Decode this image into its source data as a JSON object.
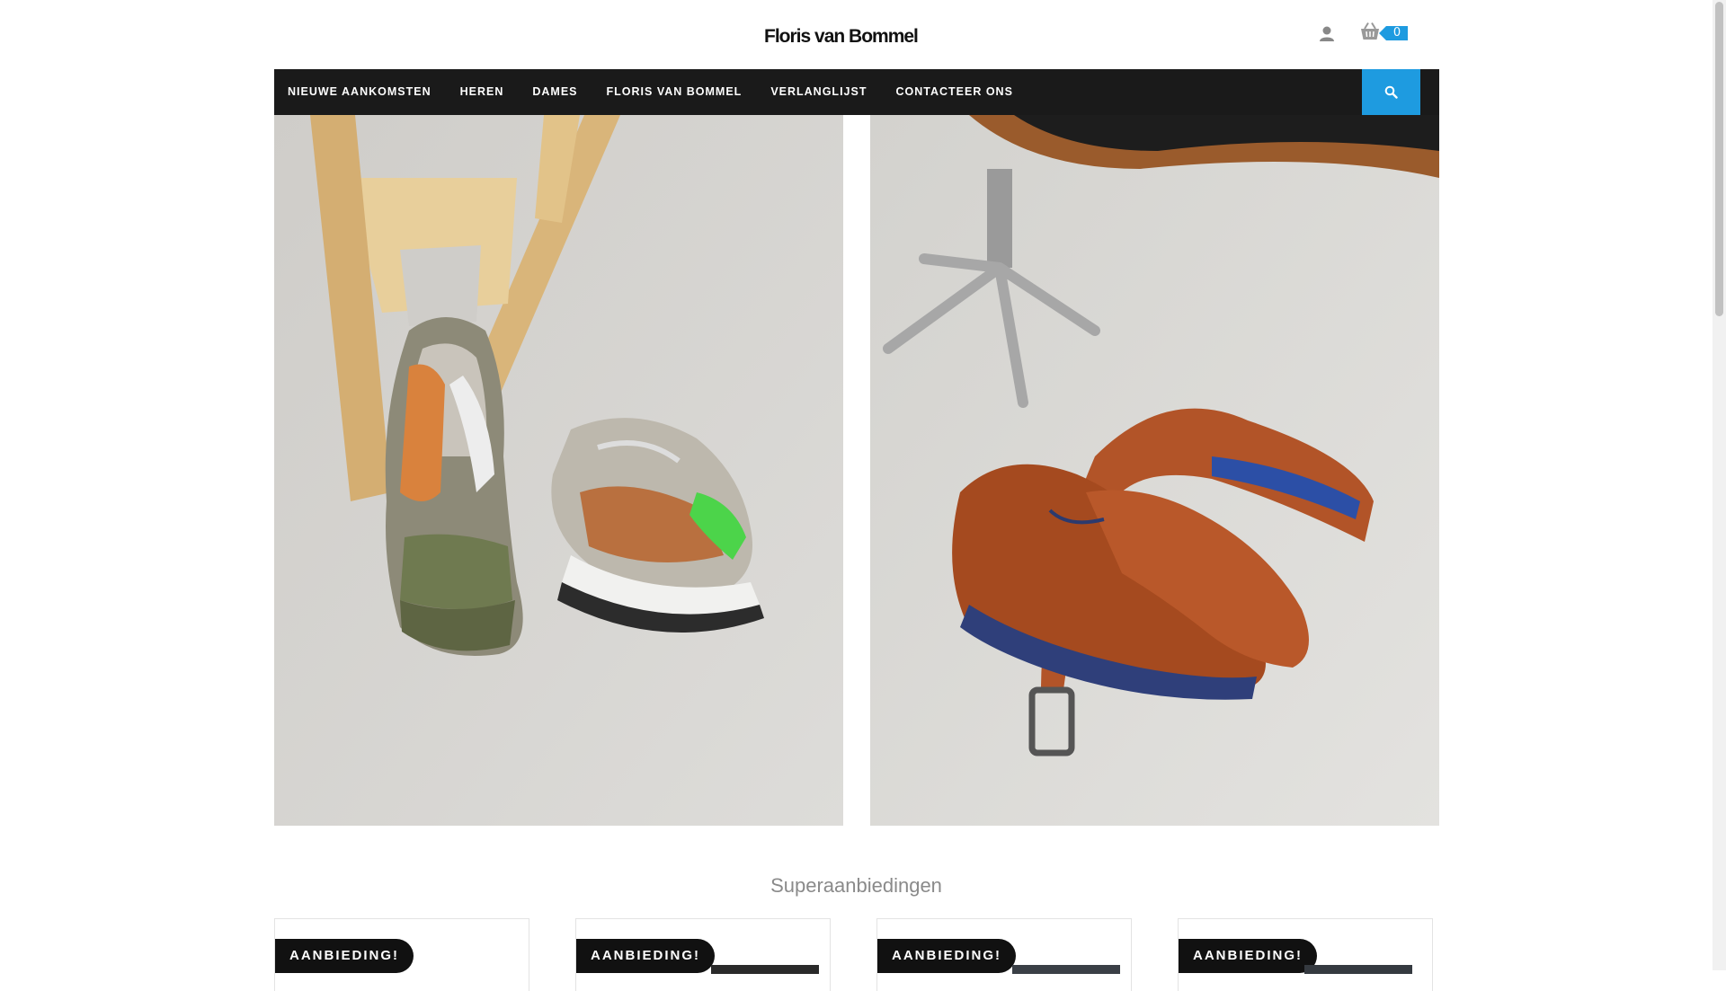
{
  "header": {
    "logo_text": "Floris van Bommel",
    "user_icon": "user-icon",
    "cart_icon": "basket-icon",
    "cart_count": "0"
  },
  "nav": {
    "items": [
      {
        "label": "NIEUWE AANKOMSTEN"
      },
      {
        "label": "HEREN"
      },
      {
        "label": "DAMES"
      },
      {
        "label": "FLORIS VAN BOMMEL"
      },
      {
        "label": "VERLANGLIJST"
      },
      {
        "label": "CONTACTEER ONS"
      }
    ],
    "search_icon": "search-icon",
    "accent_color": "#1e9be0"
  },
  "banners": [
    {
      "name": "sneakers-banner"
    },
    {
      "name": "shoes-belt-banner"
    }
  ],
  "deals": {
    "title": "Superaanbiedingen",
    "products": [
      {
        "badge": "AANBIEDING!"
      },
      {
        "badge": "AANBIEDING!"
      },
      {
        "badge": "AANBIEDING!"
      },
      {
        "badge": "AANBIEDING!"
      }
    ]
  }
}
